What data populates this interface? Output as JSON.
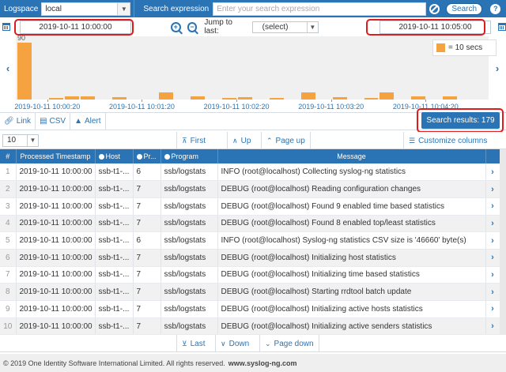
{
  "topbar": {
    "logspace_label": "Logspace",
    "logspace_value": "local",
    "search_label": "Search expression",
    "search_placeholder": "Enter your search expression",
    "search_button": "Search",
    "help_glyph": "?"
  },
  "daterow": {
    "from_date": "2019-10-11 10:00:00",
    "to_date": "2019-10-11 10:05:00",
    "jump_label": "Jump to last:",
    "jump_value": "(select)"
  },
  "histogram": {
    "legend": "= 10 secs",
    "tick_labels": [
      "2019-10-11 10:00:20",
      "2019-10-11 10:01:20",
      "2019-10-11 10:02:20",
      "2019-10-11 10:03:20",
      "2019-10-11 10:04:20"
    ],
    "bars": [
      {
        "bin": 0,
        "count": 90,
        "label": "90"
      },
      {
        "bin": 2,
        "count": 3
      },
      {
        "bin": 3,
        "count": 5
      },
      {
        "bin": 4,
        "count": 5
      },
      {
        "bin": 6,
        "count": 4
      },
      {
        "bin": 9,
        "count": 11
      },
      {
        "bin": 11,
        "count": 5
      },
      {
        "bin": 13,
        "count": 3
      },
      {
        "bin": 14,
        "count": 4
      },
      {
        "bin": 16,
        "count": 3
      },
      {
        "bin": 18,
        "count": 11
      },
      {
        "bin": 20,
        "count": 4
      },
      {
        "bin": 22,
        "count": 3
      },
      {
        "bin": 23,
        "count": 11
      },
      {
        "bin": 25,
        "count": 5
      },
      {
        "bin": 27,
        "count": 5
      }
    ],
    "max_count": 95
  },
  "actions": {
    "link": "Link",
    "csv": "CSV",
    "alert": "Alert",
    "results": "Search results: 179"
  },
  "paging": {
    "per_page": "10",
    "first": "First",
    "up": "Up",
    "page_up": "Page up",
    "customize": "Customize columns",
    "last": "Last",
    "down": "Down",
    "page_down": "Page down"
  },
  "table": {
    "headers": [
      "#",
      "Processed Timestamp",
      "Host",
      "Pr...",
      "Program",
      "Message"
    ],
    "rows": [
      {
        "n": "1",
        "ts": "2019-10-11 10:00:00",
        "host": "ssb-t1-...",
        "pr": "6",
        "prog": "ssb/logstats",
        "msg": "INFO (root@localhost) Collecting syslog-ng statistics"
      },
      {
        "n": "2",
        "ts": "2019-10-11 10:00:00",
        "host": "ssb-t1-...",
        "pr": "7",
        "prog": "ssb/logstats",
        "msg": "DEBUG (root@localhost) Reading configuration changes"
      },
      {
        "n": "3",
        "ts": "2019-10-11 10:00:00",
        "host": "ssb-t1-...",
        "pr": "7",
        "prog": "ssb/logstats",
        "msg": "DEBUG (root@localhost) Found 9 enabled time based statistics"
      },
      {
        "n": "4",
        "ts": "2019-10-11 10:00:00",
        "host": "ssb-t1-...",
        "pr": "7",
        "prog": "ssb/logstats",
        "msg": "DEBUG (root@localhost) Found 8 enabled top/least statistics"
      },
      {
        "n": "5",
        "ts": "2019-10-11 10:00:00",
        "host": "ssb-t1-...",
        "pr": "6",
        "prog": "ssb/logstats",
        "msg": "INFO (root@localhost) Syslog-ng statistics CSV size is '46660' byte(s)"
      },
      {
        "n": "6",
        "ts": "2019-10-11 10:00:00",
        "host": "ssb-t1-...",
        "pr": "7",
        "prog": "ssb/logstats",
        "msg": "DEBUG (root@localhost) Initializing host statistics"
      },
      {
        "n": "7",
        "ts": "2019-10-11 10:00:00",
        "host": "ssb-t1-...",
        "pr": "7",
        "prog": "ssb/logstats",
        "msg": "DEBUG (root@localhost) Initializing time based statistics"
      },
      {
        "n": "8",
        "ts": "2019-10-11 10:00:00",
        "host": "ssb-t1-...",
        "pr": "7",
        "prog": "ssb/logstats",
        "msg": "DEBUG (root@localhost) Starting rrdtool batch update"
      },
      {
        "n": "9",
        "ts": "2019-10-11 10:00:00",
        "host": "ssb-t1-...",
        "pr": "7",
        "prog": "ssb/logstats",
        "msg": "DEBUG (root@localhost) Initializing active hosts statistics"
      },
      {
        "n": "10",
        "ts": "2019-10-11 10:00:00",
        "host": "ssb-t1-...",
        "pr": "7",
        "prog": "ssb/logstats",
        "msg": "DEBUG (root@localhost) Initializing active senders statistics"
      }
    ]
  },
  "footer": {
    "copyright": "© 2019 One Identity Software International Limited. All rights reserved.",
    "site": "www.syslog-ng.com"
  },
  "colors": {
    "primary": "#2a74b5",
    "bar": "#f5a341",
    "highlight": "#e01b1b"
  }
}
